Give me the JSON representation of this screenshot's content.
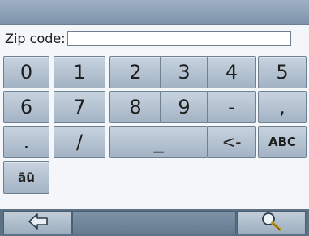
{
  "zip": {
    "label": "Zip code:",
    "value": "",
    "placeholder": ""
  },
  "keypad": {
    "row1": [
      "0",
      "1",
      "2",
      "3",
      "4",
      "5"
    ],
    "row2": [
      "6",
      "7",
      "8",
      "9",
      "-",
      ","
    ],
    "row3": [
      ".",
      "/",
      "_",
      "<-",
      "ABC"
    ],
    "row4": [
      "āū"
    ]
  },
  "bottom_bar": {
    "back_icon": "left-arrow-icon",
    "search_icon": "magnifier-icon"
  }
}
